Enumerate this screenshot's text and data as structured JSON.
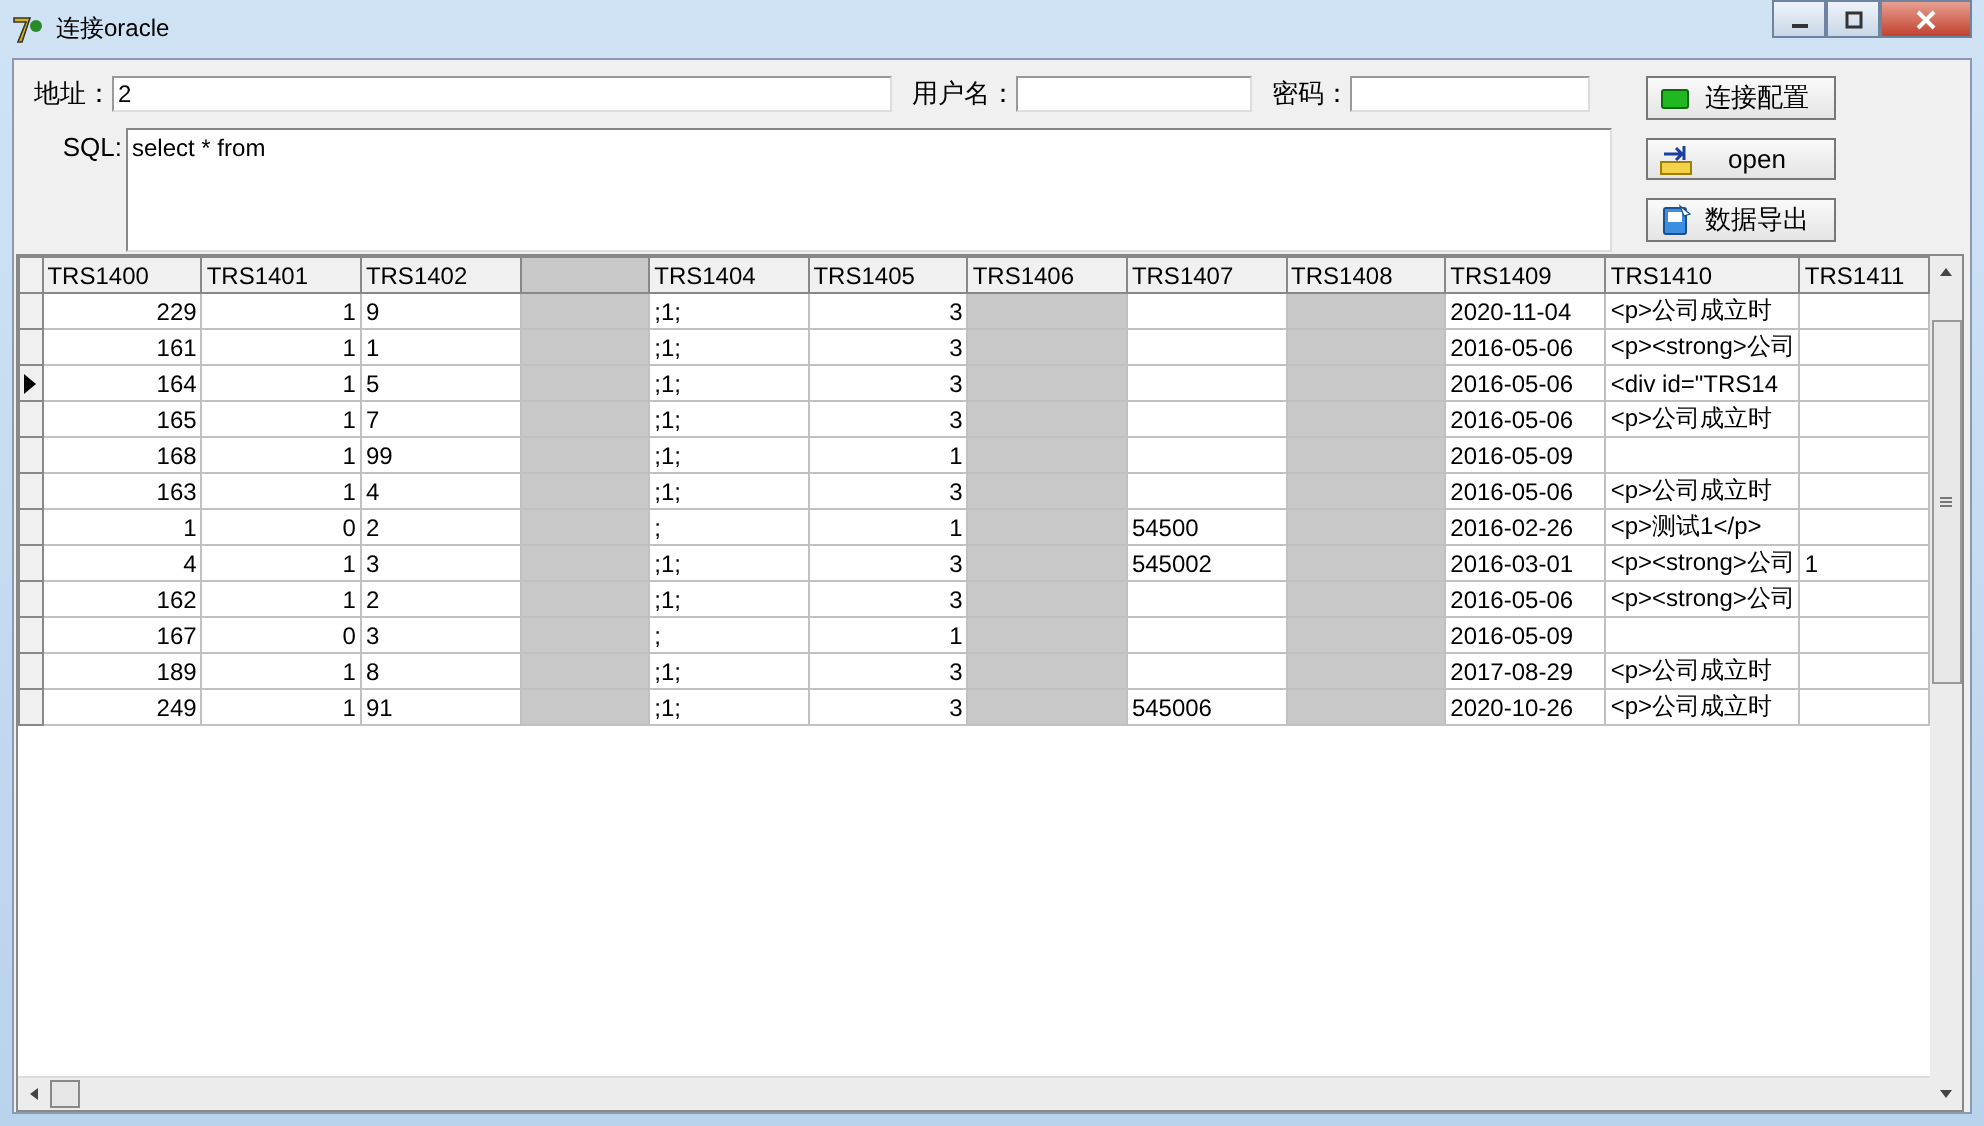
{
  "window": {
    "title": "连接oracle"
  },
  "form": {
    "address": {
      "label": "地址：",
      "value": "2"
    },
    "username": {
      "label": "用户名："
    },
    "password": {
      "label": "密码："
    },
    "sql": {
      "label": "SQL:",
      "value": "select * from"
    }
  },
  "buttons": [
    {
      "kind": "connect",
      "label": "连接配置"
    },
    {
      "kind": "open",
      "label": "open"
    },
    {
      "kind": "export",
      "label": "数据导出"
    }
  ],
  "table": {
    "columns": [
      {
        "label": "TRS1400"
      },
      {
        "label": "TRS1401"
      },
      {
        "label": "TRS1402"
      },
      {
        "kind": "blurred"
      },
      {
        "label": "TRS1404"
      },
      {
        "label": "TRS1405"
      },
      {
        "label": "TRS1406"
      },
      {
        "label": "TRS1407"
      },
      {
        "label": "TRS1408"
      },
      {
        "label": "TRS1409"
      },
      {
        "label": "TRS1410"
      },
      {
        "label": "TRS1411"
      }
    ],
    "rows": [
      {
        "selected": false,
        "cells": [
          "229",
          "1",
          "9",
          {
            "kind": "blurred"
          },
          ";1;",
          "3",
          {
            "kind": "blurred"
          },
          null,
          {
            "kind": "blurred"
          },
          "2020-11-04",
          "<p>公司成立时",
          null
        ]
      },
      {
        "selected": false,
        "cells": [
          "161",
          "1",
          "1",
          {
            "kind": "blurred"
          },
          ";1;",
          "3",
          {
            "kind": "blurred"
          },
          null,
          {
            "kind": "blurred"
          },
          "2016-05-06",
          "<p><strong>公司",
          null
        ]
      },
      {
        "selected": true,
        "cells": [
          "164",
          "1",
          "5",
          {
            "kind": "blurred"
          },
          ";1;",
          "3",
          {
            "kind": "blurred"
          },
          null,
          {
            "kind": "blurred"
          },
          "2016-05-06",
          "<div id=\"TRS14",
          null
        ]
      },
      {
        "selected": false,
        "cells": [
          "165",
          "1",
          "7",
          {
            "kind": "blurred"
          },
          ";1;",
          "3",
          {
            "kind": "blurred"
          },
          null,
          {
            "kind": "blurred"
          },
          "2016-05-06",
          "<p>公司成立时",
          null
        ]
      },
      {
        "selected": false,
        "cells": [
          "168",
          "1",
          "99",
          {
            "kind": "blurred"
          },
          ";1;",
          "1",
          {
            "kind": "blurred"
          },
          null,
          {
            "kind": "blurred"
          },
          "2016-05-09",
          null,
          null
        ]
      },
      {
        "selected": false,
        "cells": [
          "163",
          "1",
          "4",
          {
            "kind": "blurred"
          },
          ";1;",
          "3",
          {
            "kind": "blurred"
          },
          null,
          {
            "kind": "blurred"
          },
          "2016-05-06",
          "<p>公司成立时",
          null
        ]
      },
      {
        "selected": false,
        "cells": [
          "1",
          "0",
          "2",
          {
            "kind": "blurred"
          },
          ";",
          "1",
          {
            "kind": "blurred"
          },
          "54500",
          {
            "kind": "blurred"
          },
          "2016-02-26",
          "<p>测试1</p>",
          null
        ]
      },
      {
        "selected": false,
        "cells": [
          "4",
          "1",
          "3",
          {
            "kind": "blurred"
          },
          ";1;",
          "3",
          {
            "kind": "blurred"
          },
          "545002",
          {
            "kind": "blurred"
          },
          "2016-03-01",
          "<p><strong>公司",
          "1"
        ]
      },
      {
        "selected": false,
        "cells": [
          "162",
          "1",
          "2",
          {
            "kind": "blurred"
          },
          ";1;",
          "3",
          {
            "kind": "blurred"
          },
          null,
          {
            "kind": "blurred"
          },
          "2016-05-06",
          "<p><strong>公司",
          null
        ]
      },
      {
        "selected": false,
        "cells": [
          "167",
          "0",
          "3",
          {
            "kind": "blurred"
          },
          ";",
          "1",
          {
            "kind": "blurred"
          },
          null,
          {
            "kind": "blurred"
          },
          "2016-05-09",
          null,
          null
        ]
      },
      {
        "selected": false,
        "cells": [
          "189",
          "1",
          "8",
          {
            "kind": "blurred"
          },
          ";1;",
          "3",
          {
            "kind": "blurred"
          },
          null,
          {
            "kind": "blurred"
          },
          "2017-08-29",
          "<p>公司成立时",
          null
        ]
      },
      {
        "selected": false,
        "cells": [
          "249",
          "1",
          "91",
          {
            "kind": "blurred"
          },
          ";1;",
          "3",
          {
            "kind": "blurred"
          },
          "545006",
          {
            "kind": "blurred"
          },
          "2020-10-26",
          "<p>公司成立时",
          null
        ]
      }
    ]
  }
}
